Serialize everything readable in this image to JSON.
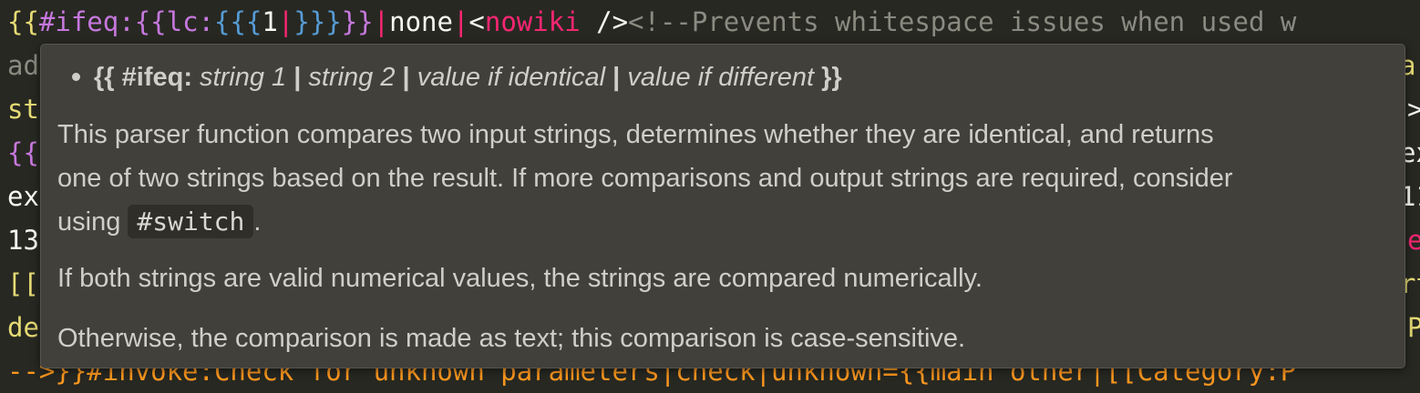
{
  "editor": {
    "line1": {
      "t1": "{{",
      "t2": "#ifeq:",
      "t3": "{{",
      "t4": "lc:",
      "t5": "{{{",
      "t6": "1",
      "t7": "|",
      "t8": "}}}",
      "t9": "}}",
      "t10": "|",
      "t11": "none",
      "t12": "|",
      "t13": "<",
      "t14": "nowiki",
      "t15": " />",
      "t16": "<!--Prevents whitespace issues when used w"
    },
    "gutter": {
      "l2": "ad",
      "l3": "st",
      "l4": "{{",
      "l5": "ex",
      "l6": "13",
      "l7": "[[",
      "l8": "de",
      "l9": "-->}}#invoke:Check for unknown parameters|check|unknown={{main other|[[Category:P"
    },
    "right_edge": {
      "r2": "ar",
      "r3": ">",
      "r4": "ex",
      "r5": "11",
      "r6": "e",
      "r7": "rt",
      "r8": "P"
    }
  },
  "hover": {
    "signature": {
      "open": "{{ ",
      "name": "#ifeq:",
      "p1": " string 1 ",
      "sep1": "|",
      "p2": " string 2 ",
      "sep2": "|",
      "p3": " value if identical ",
      "sep3": "|",
      "p4": " value if different ",
      "close": "}}"
    },
    "para1_line1": "This parser function compares two input strings, determines whether they are identical, and returns",
    "para1_line2": "one of two strings based on the result. If more comparisons and output strings are required, consider",
    "para1_line3_pre": "using ",
    "para1_code": "#switch",
    "para1_line3_post": ".",
    "para2": "If both strings are valid numerical values, the strings are compared numerically.",
    "para3": "Otherwise, the comparison is made as text; this comparison is case-sensitive."
  }
}
